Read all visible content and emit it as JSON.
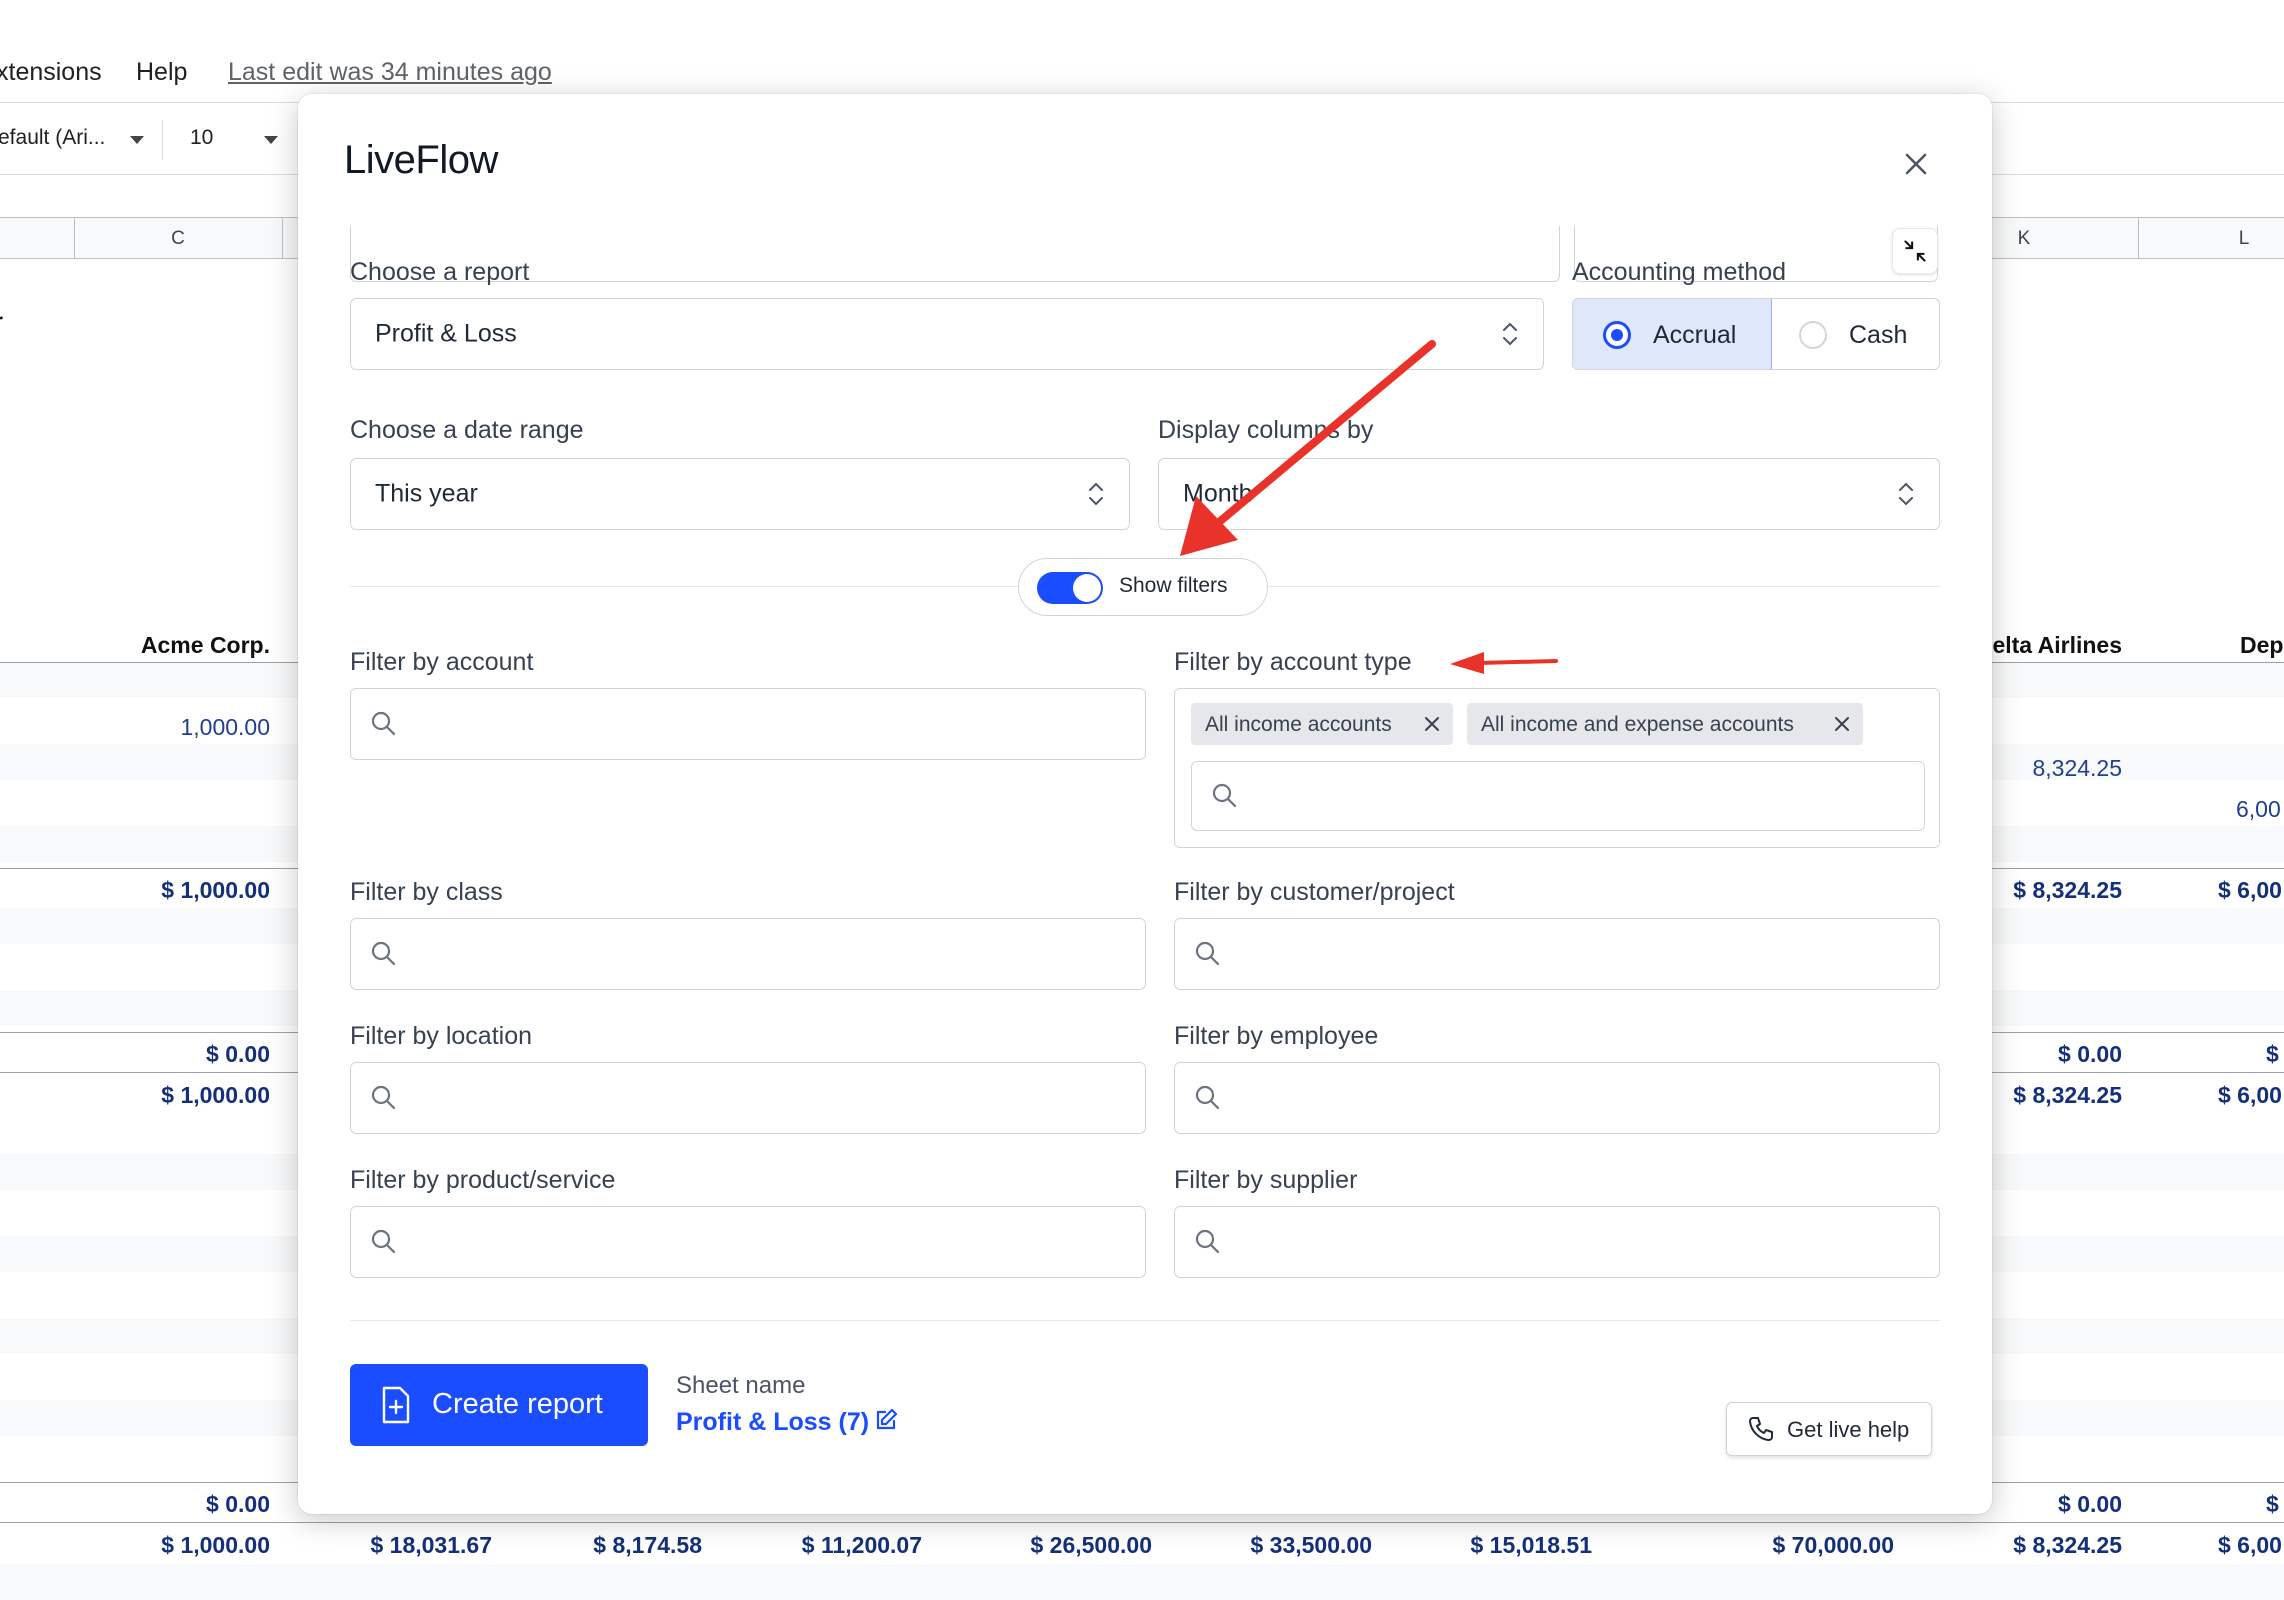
{
  "sheet": {
    "menu": [
      "xtensions",
      "Help"
    ],
    "last_edit": "Last edit was 34 minutes ago",
    "font_name": "efault (Ari...",
    "font_size": "10",
    "col_letters": [
      "C",
      "K",
      "L"
    ],
    "left_header": "Acme Corp.",
    "right_header_1": "elta Airlines",
    "right_header_2": "Dep",
    "stub_text": "r",
    "values": {
      "c_row1": "1,000.00",
      "c_total1": "$ 1,000.00",
      "c_zero1": "$ 0.00",
      "c_total2": "$ 1,000.00",
      "c_zero2": "$ 0.00",
      "c_grand": "$ 1,000.00",
      "k_row2": "8,324.25",
      "l_row3": "6,00",
      "k_total1": "$ 8,324.25",
      "l_total1": "$ 6,00",
      "k_zero1": "$ 0.00",
      "l_zero1": "$",
      "k_total2": "$ 8,324.25",
      "l_total2": "$ 6,00",
      "k_zero2": "$ 0.00",
      "l_zero2": "$",
      "k_grand": "$ 8,324.25",
      "l_grand": "$ 6,00"
    },
    "bottom_totals": [
      "$ 18,031.67",
      "$ 8,174.58",
      "$ 11,200.07",
      "$ 26,500.00",
      "$ 33,500.00",
      "$ 15,018.51",
      "$ 70,000.00"
    ]
  },
  "modal": {
    "title": "LiveFlow",
    "report": {
      "label": "Choose a report",
      "value": "Profit & Loss"
    },
    "accounting": {
      "label": "Accounting method",
      "options": [
        "Accrual",
        "Cash"
      ],
      "selected": "Accrual"
    },
    "date_range": {
      "label": "Choose a date range",
      "value": "This year"
    },
    "display_columns": {
      "label": "Display columns by",
      "value": "Month"
    },
    "show_filters": {
      "label": "Show filters",
      "on": true
    },
    "filters": {
      "account": "Filter by account",
      "account_type": "Filter by account type",
      "account_type_chips": [
        "All income accounts",
        "All income and expense accounts"
      ],
      "class": "Filter by class",
      "customer_project": "Filter by customer/project",
      "location": "Filter by location",
      "employee": "Filter by employee",
      "product_service": "Filter by product/service",
      "supplier": "Filter by supplier"
    },
    "create_button": "Create report",
    "sheet_name_label": "Sheet name",
    "sheet_name": "Profit & Loss (7)",
    "help_button": "Get live help"
  },
  "colors": {
    "accent": "#1a4dff",
    "arrow": "#e8322a",
    "sheet_value": "#1f3f8f"
  }
}
